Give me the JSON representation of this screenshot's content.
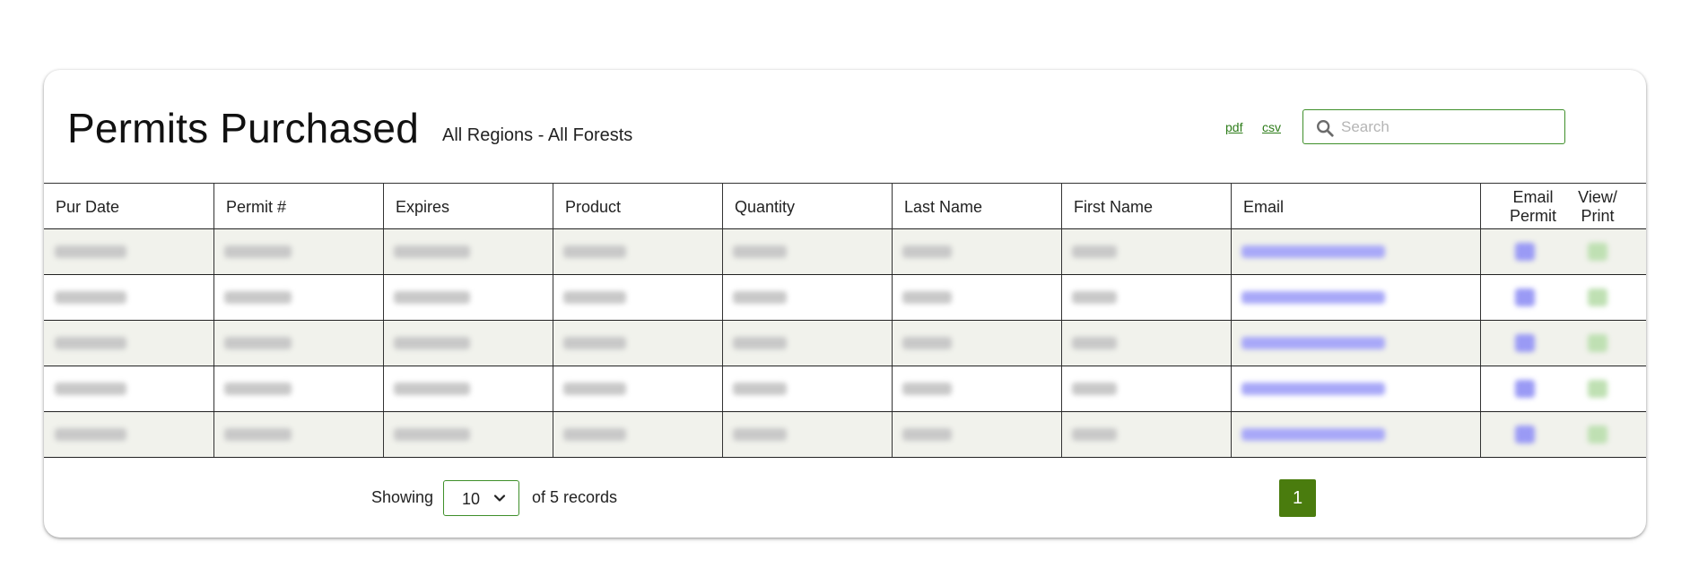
{
  "header": {
    "title": "Permits Purchased",
    "subtitle": "All Regions - All Forests",
    "export_pdf": "pdf",
    "export_csv": "csv",
    "search_placeholder": "Search"
  },
  "columns": [
    "Pur Date",
    "Permit #",
    "Expires",
    "Product",
    "Quantity",
    "Last Name",
    "First Name",
    "Email"
  ],
  "action_columns": {
    "email": [
      "Email",
      "Permit"
    ],
    "view": [
      "View/",
      "Print"
    ]
  },
  "rows_redacted": 5,
  "footer": {
    "showing_label": "Showing",
    "page_size": "10",
    "records_label": "of 5 records",
    "current_page": "1"
  },
  "colors": {
    "accent_green": "#4a7c0e",
    "border_green": "#3f8f2a",
    "link_green": "#2e7d1a",
    "shaded_row": "#f1f2ec"
  },
  "icons": {
    "search": "magnifier-icon",
    "dropdown": "chevron-down-icon"
  }
}
